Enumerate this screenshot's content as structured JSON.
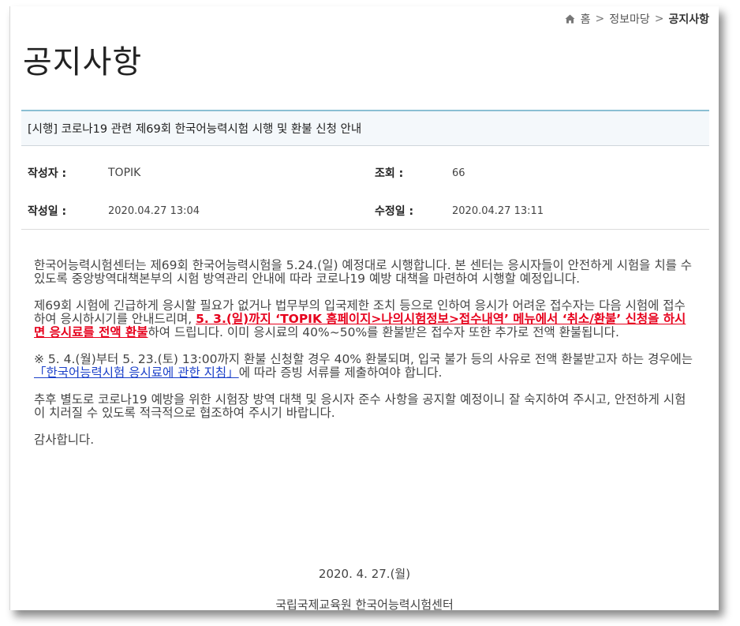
{
  "breadcrumb": {
    "home": "홈",
    "sep": ">",
    "section": "정보마당",
    "current": "공지사항"
  },
  "page_title": "공지사항",
  "post": {
    "title": "[시행] 코로나19 관련 제69회 한국어능력시험 시행 및 환불 신청 안내",
    "author_label": "작성자 :",
    "author": "TOPIK",
    "views_label": "조회 :",
    "views": "66",
    "created_label": "작성일 :",
    "created": "2020.04.27 13:04",
    "modified_label": "수정일 :",
    "modified": "2020.04.27 13:11"
  },
  "body": {
    "p1": "한국어능력시험센터는 제69회 한국어능력시험을 5.24.(일) 예정대로 시행합니다. 본 센터는 응시자들이 안전하게 시험을 치를 수 있도록 중앙방역대책본부의 시험 방역관리 안내에 따라 코로나19 예방 대책을 마련하여 시행할 예정입니다.",
    "p2_a": "제69회 시험에 긴급하게 응시할 필요가 없거나 법무부의 입국제한 조치 등으로 인하여 응시가 어려운 접수자는 다음 시험에 접수하여 응시하시기를 안내드리며, ",
    "p2_highlight": "5. 3.(일)까지 ‘TOPIK 홈페이지>나의시험정보>접수내역’ 메뉴에서 ‘취소/환불’ 신청을 하시면 응시료를 전액 환불",
    "p2_b": "하여 드립니다. 이미 응시료의 40%~50%를 환불받은 접수자 또한 추가로 전액 환불됩니다.",
    "p3_a": "※ 5. 4.(월)부터 5. 23.(토) 13:00까지 환불 신청할 경우 40% 환불되며, 입국 불가 등의 사유로 전액 환불받고자 하는 경우에는 ",
    "p3_link": "「한국어능력시험 응시료에 관한 지침」",
    "p3_b": "에 따라 증빙 서류를 제출하여야 합니다.",
    "p4": "추후 별도로 코로나19 예방을 위한 시험장 방역 대책 및 응시자 준수 사항을 공지할 예정이니 잘 숙지하여 주시고, 안전하게 시험이 치러질 수 있도록 적극적으로 협조하여 주시기 바랍니다.",
    "p5": "감사합니다.",
    "date": "2020. 4. 27.(월)",
    "org": "국립국제교육원 한국어능력시험센터"
  }
}
